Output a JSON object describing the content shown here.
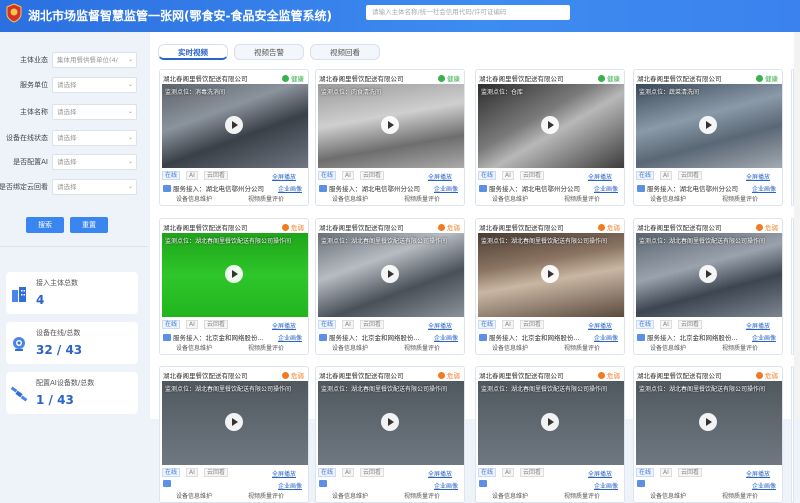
{
  "header": {
    "title": "湖北市场监督智慧监管一张网(鄂食安-食品安全监管系统)",
    "search_placeholder": "请输入主体名称/统一社会信用代码/许可证编码"
  },
  "filters": [
    {
      "label": "主体业态",
      "value": "集体用餐供餐单位(4/"
    },
    {
      "label": "服务单位",
      "value": "请选择"
    },
    {
      "label": "主体名称",
      "value": "请选择"
    },
    {
      "label": "设备在线状态",
      "value": "请选择"
    },
    {
      "label": "是否配置AI",
      "value": "请选择"
    },
    {
      "label": "是否绑定云回看",
      "value": "请选择"
    }
  ],
  "buttons": {
    "search": "搜索",
    "reset": "重置"
  },
  "stats": [
    {
      "label": "接入主体总数",
      "value": "4",
      "icon": "building-icon"
    },
    {
      "label": "设备在线/总数",
      "value": "32 / 43",
      "icon": "camera-icon"
    },
    {
      "label": "配置AI设备数/总数",
      "value": "1 / 43",
      "icon": "satellite-icon"
    }
  ],
  "tabs": [
    "实时视频",
    "视频告警",
    "视频回看"
  ],
  "card_common": {
    "tag_online": "在线",
    "tag_ai": "AI",
    "tag_cloud": "云回看",
    "fullscreen": "全屏播放",
    "enterprise_profile": "企业画像",
    "device_info": "设备信息维护",
    "video_quality": "视频质量评价"
  },
  "cards": [
    {
      "company": "湖北春阁里餐饮配送有限公司",
      "status": "健康",
      "status_color": "#37b24d",
      "point": "监测点位：消毒洗消间",
      "service": "服务接入：湖北电信鄂州分公司",
      "scene": "s1"
    },
    {
      "company": "湖北春阁里餐饮配送有限公司",
      "status": "健康",
      "status_color": "#37b24d",
      "point": "监测点位：肉食清洗间",
      "service": "服务接入：湖北电信鄂州分公司",
      "scene": "s2"
    },
    {
      "company": "湖北春阁里餐饮配送有限公司",
      "status": "健康",
      "status_color": "#37b24d",
      "point": "监测点位：仓库",
      "service": "服务接入：湖北电信鄂州分公司",
      "scene": "s3"
    },
    {
      "company": "湖北春阁里餐饮配送有限公司",
      "status": "健康",
      "status_color": "#37b24d",
      "point": "监测点位：蔬菜清洗间",
      "service": "服务接入：湖北电信鄂州分公司",
      "scene": "s4"
    },
    {
      "company": "湖北春阁里餐饮配送有限公司",
      "status": "危弱",
      "status_color": "#f07b22",
      "point": "监测点位：湖北春阁里餐饮配送有限公司操作间",
      "service": "服务接入：北京金和网络股份...",
      "scene": "s5"
    },
    {
      "company": "湖北春阁里餐饮配送有限公司",
      "status": "危弱",
      "status_color": "#f07b22",
      "point": "监测点位：湖北春阁里餐饮配送有限公司操作间",
      "service": "服务接入：北京金和网络股份...",
      "scene": "s6"
    },
    {
      "company": "湖北春阁里餐饮配送有限公司",
      "status": "危弱",
      "status_color": "#f07b22",
      "point": "监测点位：湖北春阁里餐饮配送有限公司操作间",
      "service": "服务接入：北京金和网络股份...",
      "scene": "s7"
    },
    {
      "company": "湖北春阁里餐饮配送有限公司",
      "status": "危弱",
      "status_color": "#f07b22",
      "point": "监测点位：湖北春阁里餐饮配送有限公司操作间",
      "service": "服务接入：北京金和网络股份...",
      "scene": "s8"
    },
    {
      "company": "湖北春阁里餐饮配送有限公司",
      "status": "危弱",
      "status_color": "#f07b22",
      "point": "监测点位：湖北春阁里餐饮配送有限公司操作间",
      "service": "",
      "scene": "s9"
    },
    {
      "company": "湖北春阁里餐饮配送有限公司",
      "status": "危弱",
      "status_color": "#f07b22",
      "point": "监测点位：湖北春阁里餐饮配送有限公司操作间",
      "service": "",
      "scene": "s9"
    },
    {
      "company": "湖北春阁里餐饮配送有限公司",
      "status": "危弱",
      "status_color": "#f07b22",
      "point": "监测点位：湖北春阁里餐饮配送有限公司操作间",
      "service": "",
      "scene": "s9"
    },
    {
      "company": "湖北春阁里餐饮配送有限公司",
      "status": "危弱",
      "status_color": "#f07b22",
      "point": "监测点位：湖北春阁里餐饮配送有限公司操作间",
      "service": "",
      "scene": "s9"
    }
  ]
}
